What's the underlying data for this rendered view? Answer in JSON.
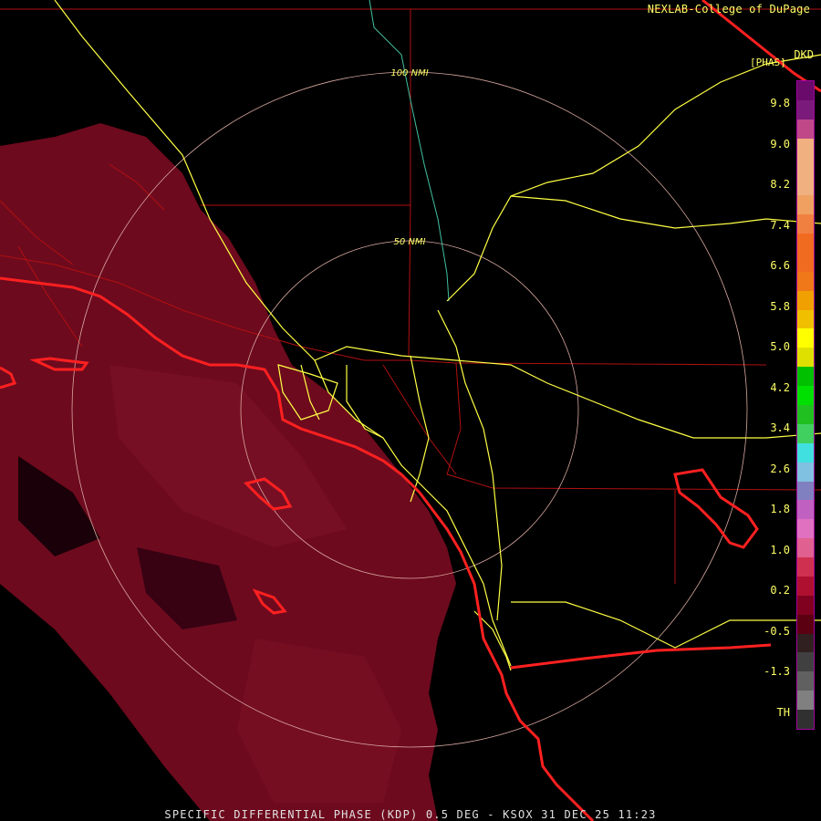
{
  "header": {
    "credit": "NEXLAB-College of DuPage",
    "product_code": "DKD",
    "unit": "[PHAS]"
  },
  "range_rings": {
    "outer_label": "100 NMI",
    "inner_label": "50 NMI"
  },
  "legend": {
    "labels": [
      "9.8",
      "9.0",
      "8.2",
      "7.4",
      "6.6",
      "5.8",
      "5.0",
      "4.2",
      "3.4",
      "2.6",
      "1.8",
      "1.0",
      "0.2",
      "-0.5",
      "-1.3",
      "TH"
    ],
    "colors": [
      "#6a0a6a",
      "#7a1a7a",
      "#c04888",
      "#f0b080",
      "#f0b080",
      "#f0b080",
      "#f0a060",
      "#f08040",
      "#f06a20",
      "#f06a20",
      "#f07818",
      "#f0a000",
      "#f0c000",
      "#ffff00",
      "#e0e000",
      "#00c000",
      "#00e000",
      "#20c020",
      "#40d060",
      "#40e0e0",
      "#80c0e0",
      "#8080c0",
      "#c060c0",
      "#e070c0",
      "#e06090",
      "#d03050",
      "#b01030",
      "#800020",
      "#5a0010",
      "#302020",
      "#404040",
      "#606060",
      "#808080",
      "#303030"
    ]
  },
  "footer": {
    "caption": "SPECIFIC DIFFERENTIAL PHASE (KDP) 0.5 DEG - KSOX 31 DEC 25 11:23"
  },
  "colors": {
    "background": "#000000",
    "echo": "#6e0a1e",
    "echo_light": "#8a1a30",
    "coast": "#ff2020",
    "roads": "#ffff44",
    "borders": "#b01010",
    "rings": "#d8a8a0"
  }
}
